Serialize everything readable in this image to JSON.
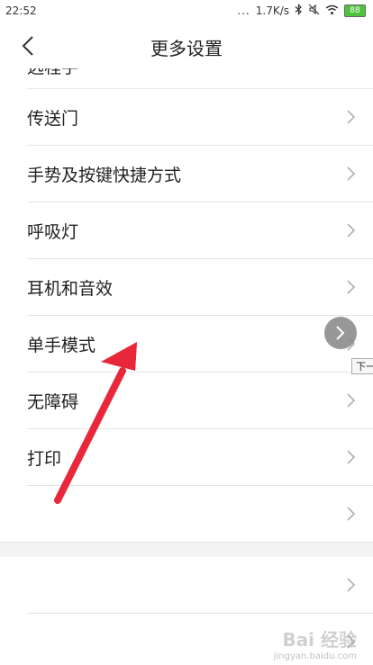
{
  "status_bar": {
    "time": "22:52",
    "dots": "...",
    "network_speed": "1.7K/s",
    "battery_level": "88"
  },
  "header": {
    "title": "更多设置",
    "back_icon": "chevron-left-icon"
  },
  "list": {
    "items": [
      {
        "label": "传送门"
      },
      {
        "label": "手势及按键快捷方式"
      },
      {
        "label": "呼吸灯"
      },
      {
        "label": "耳机和音效"
      },
      {
        "label": "单手模式"
      },
      {
        "label": "无障碍"
      },
      {
        "label": "打印"
      },
      {
        "label": ""
      }
    ],
    "section2_items": [
      {
        "label": ""
      },
      {
        "label": ""
      }
    ]
  },
  "floating": {
    "next_tab": "下一"
  },
  "watermark": {
    "logo_text": "Bai 经验",
    "url": "jingyan.baidu.com"
  },
  "colors": {
    "annotation_arrow": "#e8283a",
    "battery": "#4fc33a"
  }
}
